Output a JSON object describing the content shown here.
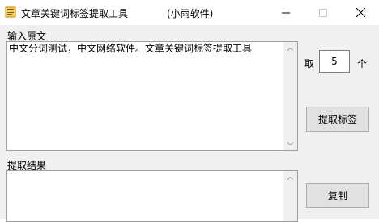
{
  "window": {
    "title": "文章关键词标签提取工具",
    "subtitle": "(小雨软件)",
    "icons": {
      "app": "notepad-icon",
      "minimize": "minimize-icon",
      "maximize": "maximize-icon",
      "close": "close-icon"
    }
  },
  "input": {
    "label": "输入原文",
    "value": "中文分词测试，中文网络软件。文章关键词标签提取工具"
  },
  "count": {
    "prefix": "取",
    "value": "5",
    "suffix": "个"
  },
  "buttons": {
    "extract": "提取标签",
    "copy": "复制"
  },
  "result": {
    "label": "提取结果",
    "value": ""
  }
}
